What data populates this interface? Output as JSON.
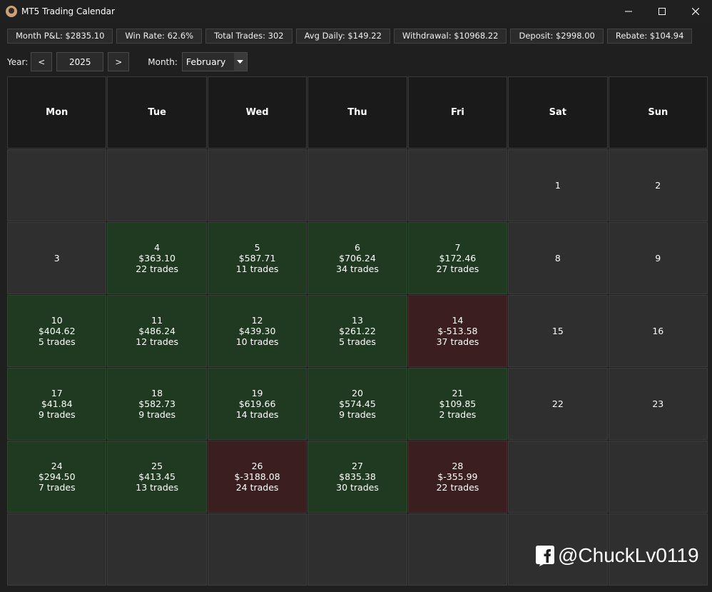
{
  "window": {
    "title": "MT5 Trading Calendar"
  },
  "stats": [
    "Month P&L: $2835.10",
    "Win Rate: 62.6%",
    "Total Trades: 302",
    "Avg Daily: $149.22",
    "Withdrawal: $10968.22",
    "Deposit: $2998.00",
    "Rebate: $104.94"
  ],
  "controls": {
    "year_label": "Year:",
    "prev_label": "<",
    "year_value": "2025",
    "next_label": ">",
    "month_label": "Month:",
    "month_value": "February"
  },
  "weekdays": [
    "Mon",
    "Tue",
    "Wed",
    "Thu",
    "Fri",
    "Sat",
    "Sun"
  ],
  "days": [
    {
      "day": "",
      "pnl": "",
      "trades": "",
      "status": "empty"
    },
    {
      "day": "",
      "pnl": "",
      "trades": "",
      "status": "empty"
    },
    {
      "day": "",
      "pnl": "",
      "trades": "",
      "status": "empty"
    },
    {
      "day": "",
      "pnl": "",
      "trades": "",
      "status": "empty"
    },
    {
      "day": "",
      "pnl": "",
      "trades": "",
      "status": "empty"
    },
    {
      "day": "1",
      "pnl": "",
      "trades": "",
      "status": "none"
    },
    {
      "day": "2",
      "pnl": "",
      "trades": "",
      "status": "none"
    },
    {
      "day": "3",
      "pnl": "",
      "trades": "",
      "status": "none"
    },
    {
      "day": "4",
      "pnl": "$363.10",
      "trades": "22 trades",
      "status": "profit"
    },
    {
      "day": "5",
      "pnl": "$587.71",
      "trades": "11 trades",
      "status": "profit"
    },
    {
      "day": "6",
      "pnl": "$706.24",
      "trades": "34 trades",
      "status": "profit"
    },
    {
      "day": "7",
      "pnl": "$172.46",
      "trades": "27 trades",
      "status": "profit"
    },
    {
      "day": "8",
      "pnl": "",
      "trades": "",
      "status": "none"
    },
    {
      "day": "9",
      "pnl": "",
      "trades": "",
      "status": "none"
    },
    {
      "day": "10",
      "pnl": "$404.62",
      "trades": "5 trades",
      "status": "profit"
    },
    {
      "day": "11",
      "pnl": "$486.24",
      "trades": "12 trades",
      "status": "profit"
    },
    {
      "day": "12",
      "pnl": "$439.30",
      "trades": "10 trades",
      "status": "profit"
    },
    {
      "day": "13",
      "pnl": "$261.22",
      "trades": "5 trades",
      "status": "profit"
    },
    {
      "day": "14",
      "pnl": "$-513.58",
      "trades": "37 trades",
      "status": "loss"
    },
    {
      "day": "15",
      "pnl": "",
      "trades": "",
      "status": "none"
    },
    {
      "day": "16",
      "pnl": "",
      "trades": "",
      "status": "none"
    },
    {
      "day": "17",
      "pnl": "$41.84",
      "trades": "9 trades",
      "status": "profit"
    },
    {
      "day": "18",
      "pnl": "$582.73",
      "trades": "9 trades",
      "status": "profit"
    },
    {
      "day": "19",
      "pnl": "$619.66",
      "trades": "14 trades",
      "status": "profit"
    },
    {
      "day": "20",
      "pnl": "$574.45",
      "trades": "9 trades",
      "status": "profit"
    },
    {
      "day": "21",
      "pnl": "$109.85",
      "trades": "2 trades",
      "status": "profit"
    },
    {
      "day": "22",
      "pnl": "",
      "trades": "",
      "status": "none"
    },
    {
      "day": "23",
      "pnl": "",
      "trades": "",
      "status": "none"
    },
    {
      "day": "24",
      "pnl": "$294.50",
      "trades": "7 trades",
      "status": "profit"
    },
    {
      "day": "25",
      "pnl": "$413.45",
      "trades": "13 trades",
      "status": "profit"
    },
    {
      "day": "26",
      "pnl": "$-3188.08",
      "trades": "24 trades",
      "status": "loss"
    },
    {
      "day": "27",
      "pnl": "$835.38",
      "trades": "30 trades",
      "status": "profit"
    },
    {
      "day": "28",
      "pnl": "$-355.99",
      "trades": "22 trades",
      "status": "loss"
    },
    {
      "day": "",
      "pnl": "",
      "trades": "",
      "status": "empty"
    },
    {
      "day": "",
      "pnl": "",
      "trades": "",
      "status": "empty"
    },
    {
      "day": "",
      "pnl": "",
      "trades": "",
      "status": "empty"
    },
    {
      "day": "",
      "pnl": "",
      "trades": "",
      "status": "empty"
    },
    {
      "day": "",
      "pnl": "",
      "trades": "",
      "status": "empty"
    },
    {
      "day": "",
      "pnl": "",
      "trades": "",
      "status": "empty"
    },
    {
      "day": "",
      "pnl": "",
      "trades": "",
      "status": "empty"
    },
    {
      "day": "",
      "pnl": "",
      "trades": "",
      "status": "empty"
    },
    {
      "day": "",
      "pnl": "",
      "trades": "",
      "status": "empty"
    }
  ],
  "colors": {
    "profit": "#1f3a20",
    "loss": "#3b1f20",
    "neutral": "#2f2f2f",
    "header": "#1a1a1a"
  },
  "watermark": {
    "icon": "facebook-icon",
    "text": "@ChuckLv0119"
  }
}
